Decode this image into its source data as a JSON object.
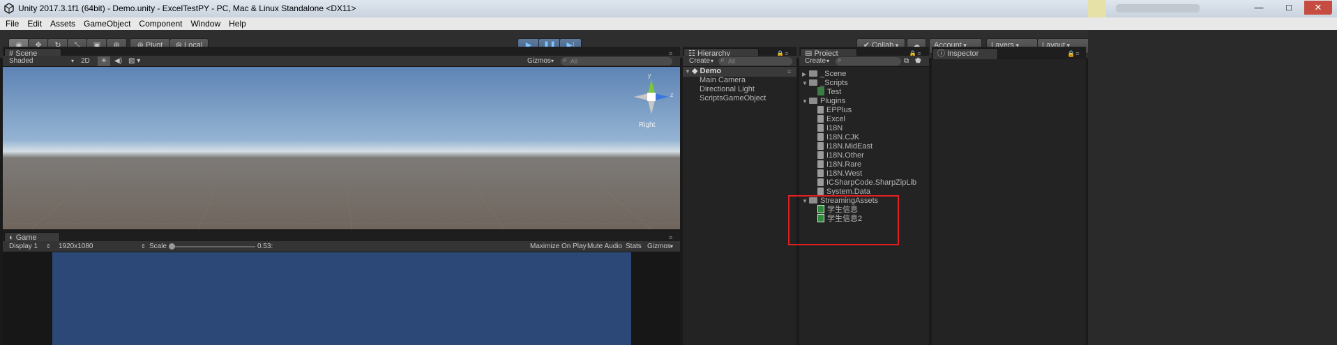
{
  "window": {
    "title": "Unity 2017.3.1f1 (64bit) - Demo.unity - ExcelTestPY - PC, Mac & Linux Standalone <DX11>",
    "controls": [
      "—",
      "□",
      "✕"
    ]
  },
  "menu": [
    "File",
    "Edit",
    "Assets",
    "GameObject",
    "Component",
    "Window",
    "Help"
  ],
  "toolbar": {
    "pivot": "Pivot",
    "local": "Local",
    "collab": "Collab",
    "account": "Account",
    "layers": "Layers",
    "layout": "Layout",
    "colors": {
      "play_accent": "#7fc3ff"
    }
  },
  "scene": {
    "tab": "Scene",
    "shading": "Shaded",
    "mode_2d": "2D",
    "gizmos": "Gizmos",
    "search_placeholder": "All",
    "gizmo_axis_y": "y",
    "gizmo_axis_z": "z",
    "gizmo_view": "Right"
  },
  "game": {
    "tab": "Game",
    "display": "Display 1",
    "resolution": "1920x1080",
    "scale_label": "Scale",
    "scale_value": "0.53:",
    "maximize": "Maximize On Play",
    "mute": "Mute Audio",
    "stats": "Stats",
    "gizmos": "Gizmos",
    "viewport_color": "#2c4877"
  },
  "hierarchy": {
    "tab": "Hierarchy",
    "create": "Create",
    "search_placeholder": "All",
    "scene_name": "Demo",
    "items": [
      "Main Camera",
      "Directional Light",
      "ScriptsGameObject"
    ]
  },
  "project": {
    "tab": "Project",
    "create": "Create",
    "items": [
      {
        "label": "_Scene",
        "icon": "folder-icon"
      },
      {
        "label": "_Scripts",
        "icon": "folder-icon"
      },
      {
        "label": "Test",
        "icon": "csharp-script-icon"
      },
      {
        "label": "Plugins",
        "icon": "folder-icon"
      },
      {
        "label": "EPPlus",
        "icon": "dll-icon"
      },
      {
        "label": "Excel",
        "icon": "dll-icon"
      },
      {
        "label": "I18N",
        "icon": "dll-icon"
      },
      {
        "label": "I18N.CJK",
        "icon": "dll-icon"
      },
      {
        "label": "I18N.MidEast",
        "icon": "dll-icon"
      },
      {
        "label": "I18N.Other",
        "icon": "dll-icon"
      },
      {
        "label": "I18N.Rare",
        "icon": "dll-icon"
      },
      {
        "label": "I18N.West",
        "icon": "dll-icon"
      },
      {
        "label": "ICSharpCode.SharpZipLib",
        "icon": "dll-icon"
      },
      {
        "label": "System.Data",
        "icon": "dll-icon"
      },
      {
        "label": "StreamingAssets",
        "icon": "folder-icon"
      },
      {
        "label": "学生信息",
        "icon": "excel-file-icon"
      },
      {
        "label": "学生信息2",
        "icon": "excel-file-icon"
      }
    ],
    "highlight_color": "#e02020"
  },
  "inspector": {
    "tab": "Inspector"
  }
}
